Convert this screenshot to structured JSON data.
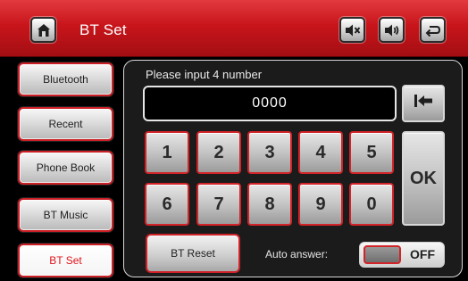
{
  "header": {
    "title": "BT Set",
    "home_icon": "home-icon",
    "mute_icon": "mute-icon",
    "volume_icon": "volume-icon",
    "back_icon": "back-icon"
  },
  "sidebar": {
    "items": [
      {
        "label": "Bluetooth"
      },
      {
        "label": "Recent"
      },
      {
        "label": "Phone Book"
      },
      {
        "label": "BT Music"
      },
      {
        "label": "BT Set",
        "active": true
      }
    ]
  },
  "main": {
    "prompt": "Please input 4 number",
    "input_value": "0000",
    "keys": [
      "1",
      "2",
      "3",
      "4",
      "5",
      "6",
      "7",
      "8",
      "9",
      "0"
    ],
    "backspace_icon": "backspace-icon",
    "ok_label": "OK",
    "reset_label": "BT Reset",
    "auto_answer_label": "Auto answer:",
    "toggle_state": "OFF"
  },
  "colors": {
    "header_red": "#c8151b",
    "button_border_red": "#d12328",
    "active_text_red": "#e0141c"
  }
}
